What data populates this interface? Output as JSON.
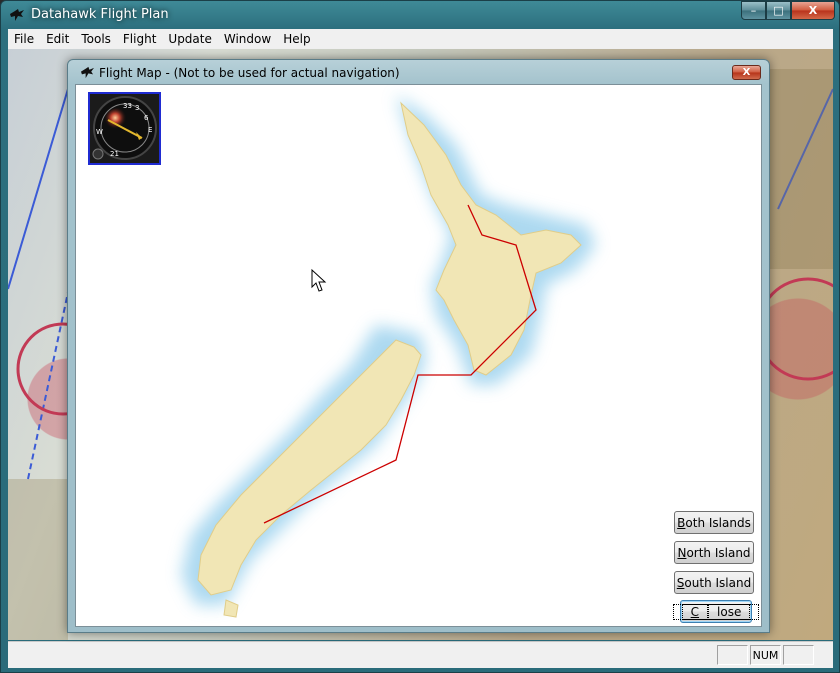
{
  "app": {
    "title": "Datahawk Flight Plan",
    "min_glyph": "–",
    "max_glyph": "□",
    "close_glyph": "X"
  },
  "menu": [
    "File",
    "Edit",
    "Tools",
    "Flight",
    "Update",
    "Window",
    "Help"
  ],
  "status_bar": {
    "pane_1": "",
    "pane_2": "NUM",
    "pane_3": ""
  },
  "dialog": {
    "title": "Flight Map - (Not to be used for actual navigation)",
    "close_glyph": "X"
  },
  "buttons": {
    "both_islands": {
      "first": "B",
      "rest": "oth Islands"
    },
    "north_island": {
      "first": "N",
      "rest": "orth Island"
    },
    "south_island": {
      "first": "S",
      "rest": "outh Island"
    },
    "close": {
      "first": "C",
      "rest": "lose"
    }
  },
  "compass": {
    "marks": [
      "33",
      "3",
      "6",
      "E",
      "21",
      "W"
    ]
  },
  "colors": {
    "route": "#cc0000",
    "sea_halo": "#9fd3ee",
    "land": "#f1e6b5",
    "accent": "#1f2bd2"
  },
  "icons": {
    "app_logo": "hawk-icon",
    "cursor": "arrow-cursor-icon"
  }
}
